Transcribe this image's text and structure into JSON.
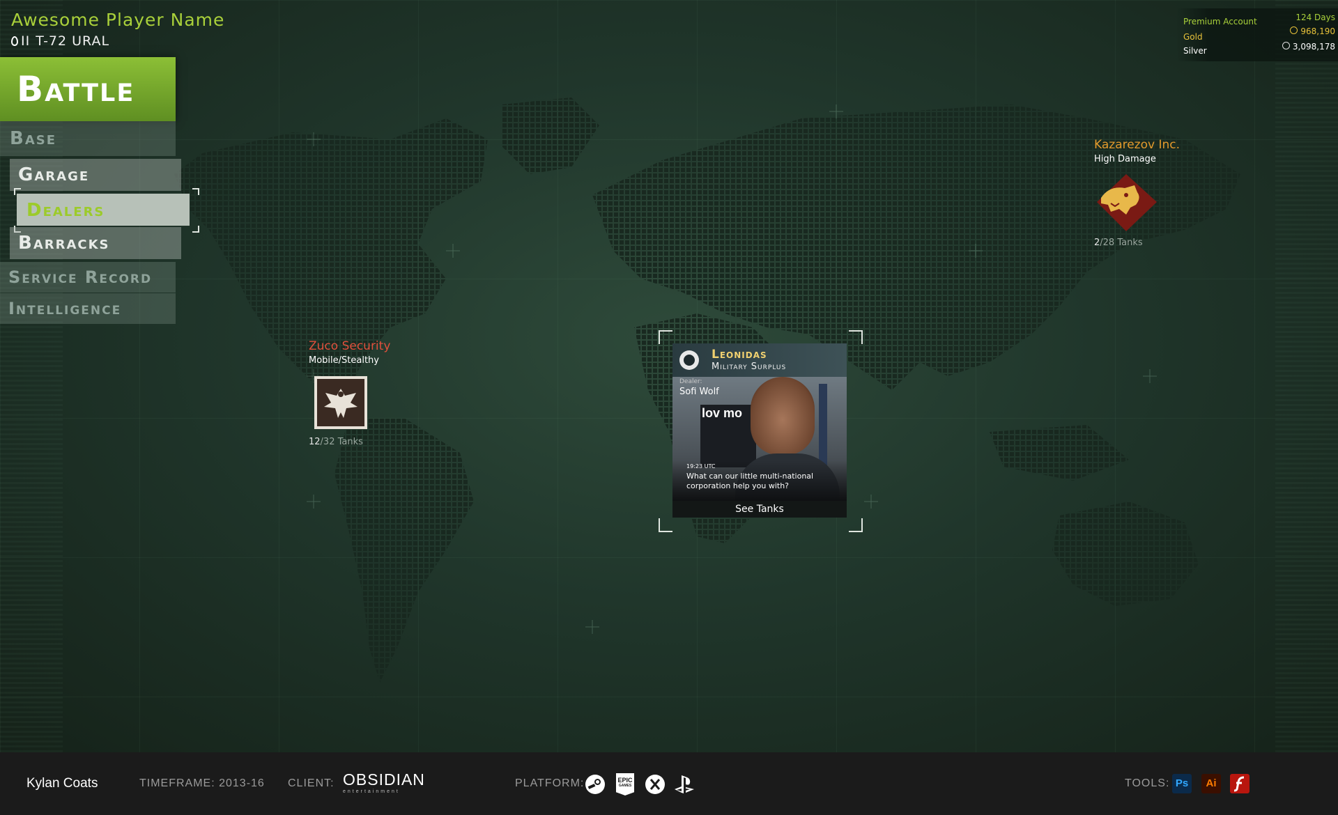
{
  "player": {
    "name": "Awesome Player Name",
    "tier": "II",
    "vehicle": "T-72 URAL"
  },
  "menu": {
    "battle": "Battle",
    "base": "Base",
    "garage": "Garage",
    "dealers": "Dealers",
    "barracks": "Barracks",
    "service_record": "Service Record",
    "intelligence": "Intelligence",
    "selected": "Dealers"
  },
  "account": {
    "premium_label": "Premium Account",
    "premium_value": "124 Days",
    "gold_label": "Gold",
    "gold_value": "968,190",
    "silver_label": "Silver",
    "silver_value": "3,098,178"
  },
  "dealers": [
    {
      "name": "Zuco Security",
      "specialty": "Mobile/Stealthy",
      "owned": "12",
      "total": "/32 Tanks",
      "color": "#e0503c",
      "emblem": "eagle-emblem"
    },
    {
      "name": "Kazarezov Inc.",
      "specialty": "High Damage",
      "owned": "2",
      "total": "/28 Tanks",
      "color": "#e39a2c",
      "emblem": "bear-emblem"
    }
  ],
  "selected_dealer": {
    "name": "Leonidas",
    "subtitle": "Military Surplus",
    "dealer_label": "Dealer:",
    "dealer_name": "Sofi Wolf",
    "sign_text": "lov mo",
    "time": "19:23 UTC",
    "message": "What can our little multi-national corporation help you with?",
    "action": "See Tanks"
  },
  "footer": {
    "author": "Kylan Coats",
    "timeframe": "TIMEFRAME: 2013-16",
    "client_label": "CLIENT:",
    "client": "OBSIDIAN",
    "client_sub": "entertainment",
    "platform_label": "PLATFORM:",
    "epic_text": "EPIC",
    "epic_sub": "GAMES",
    "tools_label": "TOOLS:",
    "ps": "Ps",
    "ai": "Ai"
  },
  "colors": {
    "accent": "#9ccb2a",
    "gold": "#e8c23a",
    "background": "#20362b"
  }
}
